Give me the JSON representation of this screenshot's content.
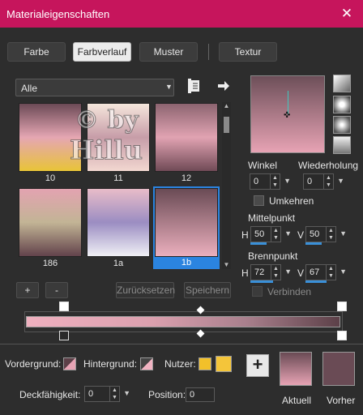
{
  "window": {
    "title": "Materialeigenschaften",
    "close_glyph": "✕"
  },
  "tabs": [
    {
      "label": "Farbe",
      "active": false
    },
    {
      "label": "Farbverlauf",
      "active": true
    },
    {
      "label": "Muster",
      "active": false
    },
    {
      "label": "Textur",
      "active": false
    }
  ],
  "category": {
    "value": "Alle"
  },
  "thumbnails": [
    {
      "label": "10",
      "colors": [
        "#6c4a56",
        "#e5a6b3",
        "#e8c437"
      ]
    },
    {
      "label": "11",
      "colors": [
        "#f5e6dc",
        "#c79da8",
        "#f2d7d0"
      ]
    },
    {
      "label": "12",
      "colors": [
        "#8c6470",
        "#e1a3b2",
        "#704a56"
      ]
    },
    {
      "label": "186",
      "colors": [
        "#e3a3b1",
        "#c2b495",
        "#62424b"
      ]
    },
    {
      "label": "1a",
      "colors": [
        "#e8bcc8",
        "#9b8dc2",
        "#f0f0f5"
      ]
    },
    {
      "label": "1b",
      "colors": [
        "#6a4b55",
        "#ebafbd"
      ],
      "selected": true
    }
  ],
  "buttons": {
    "add": "+",
    "remove": "-",
    "reset": "Zurücksetzen",
    "save": "Speichern"
  },
  "watermark": {
    "line1": "© by",
    "line2": "Hillu"
  },
  "angle": {
    "label": "Winkel",
    "value": "0"
  },
  "repeat": {
    "label": "Wiederholung",
    "value": "0"
  },
  "invert": {
    "label": "Umkehren",
    "checked": false
  },
  "center": {
    "label": "Mittelpunkt",
    "h_label": "H",
    "h_value": "50",
    "v_label": "V",
    "v_value": "50"
  },
  "focal": {
    "label": "Brennpunkt",
    "h_label": "H",
    "h_value": "72",
    "v_label": "V",
    "v_value": "67"
  },
  "link": {
    "label": "Verbinden",
    "checked": false
  },
  "bottom": {
    "fg_label": "Vordergrund:",
    "bg_label": "Hintergrund:",
    "user_label": "Nutzer:",
    "opacity_label": "Deckfähigkeit:",
    "opacity_value": "0",
    "position_label": "Position:",
    "position_value": "0",
    "current_label": "Aktuell",
    "previous_label": "Vorher",
    "add_glyph": "+"
  },
  "colors": {
    "titlebar": "#c6155c",
    "accent": "#2b84e0",
    "current": "#e7a3b4",
    "previous": "#6a4b55",
    "user1": "#f2c02a",
    "user2": "#f4c53a"
  },
  "icons": [
    "list-icon",
    "arrow-right-icon",
    "linear-style-icon",
    "rectangular-style-icon",
    "radial-style-icon",
    "sunburst-style-icon"
  ]
}
